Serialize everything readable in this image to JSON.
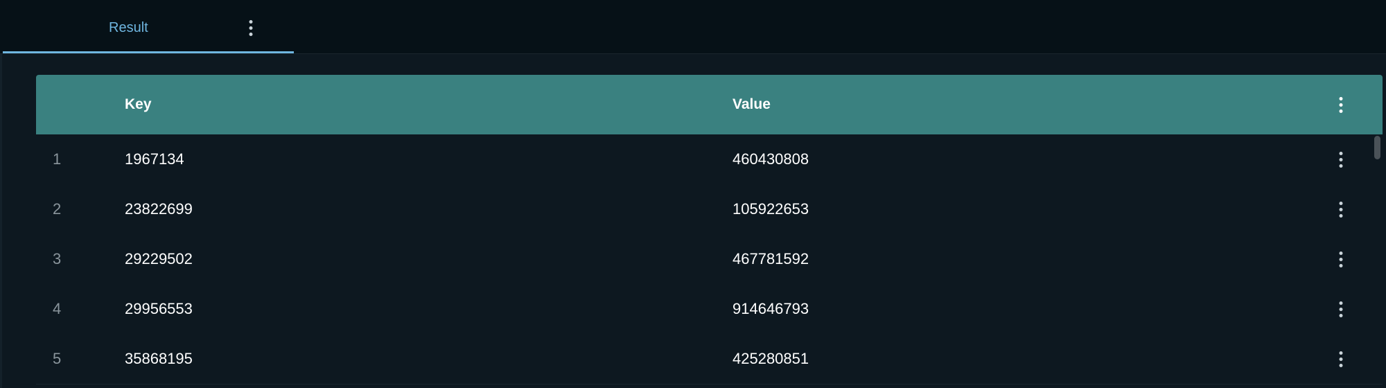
{
  "tabs": [
    {
      "label": "Result",
      "active": true,
      "menu_icon": "more-vertical-icon"
    }
  ],
  "table": {
    "columns": [
      {
        "label": "Key"
      },
      {
        "label": "Value"
      }
    ],
    "header_menu_icon": "more-vertical-icon",
    "row_menu_icon": "more-vertical-icon",
    "rows": [
      {
        "index": "1",
        "key": "1967134",
        "value": "460430808"
      },
      {
        "index": "2",
        "key": "23822699",
        "value": "105922653"
      },
      {
        "index": "3",
        "key": "29229502",
        "value": "467781592"
      },
      {
        "index": "4",
        "key": "29956553",
        "value": "914646793"
      },
      {
        "index": "5",
        "key": "35868195",
        "value": "425280851"
      }
    ]
  },
  "colors": {
    "background": "#0b151c",
    "tabbar": "#061117",
    "accent": "#6fb6e0",
    "header": "#3a8180",
    "text": "#ffffff",
    "index_text": "#8a959c"
  }
}
